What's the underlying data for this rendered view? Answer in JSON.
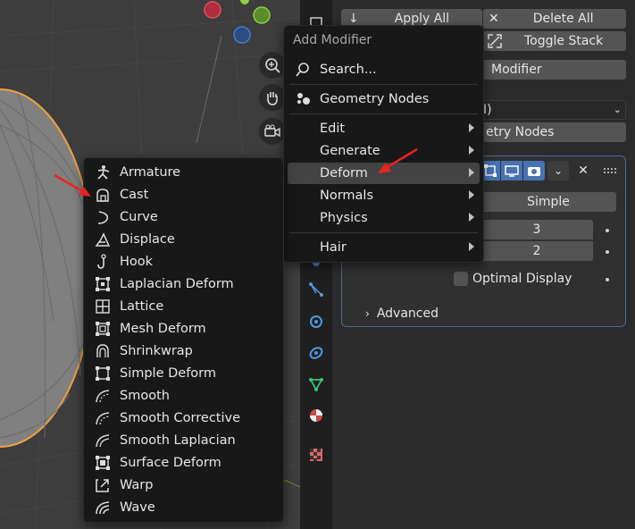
{
  "toolbar": {
    "apply_all": "Apply All",
    "delete_all": "Delete All",
    "toggle_stack": "Toggle Stack",
    "add_modifier": "Modifier",
    "dropdown_value": "I)",
    "geometry_nodes_btn": "etry Nodes"
  },
  "modifier_panel": {
    "mode_value": "Simple",
    "levels_viewport": "3",
    "render_levels": "2",
    "optimal_display": "Optimal Display",
    "advanced": "Advanced"
  },
  "add_modifier_menu": {
    "title": "Add Modifier",
    "search": "Search...",
    "geometry_nodes": "Geometry Nodes",
    "items": [
      "Edit",
      "Generate",
      "Deform",
      "Normals",
      "Physics"
    ],
    "hair": "Hair",
    "active_item": "Deform"
  },
  "deform_menu": {
    "items": [
      "Armature",
      "Cast",
      "Curve",
      "Displace",
      "Hook",
      "Laplacian Deform",
      "Lattice",
      "Mesh Deform",
      "Shrinkwrap",
      "Simple Deform",
      "Smooth",
      "Smooth Corrective",
      "Smooth Laplacian",
      "Surface Deform",
      "Warp",
      "Wave"
    ],
    "icons": [
      "armature-icon",
      "cast-icon",
      "curve-icon",
      "displace-icon",
      "hook-icon",
      "laplacian-deform-icon",
      "lattice-icon",
      "mesh-deform-icon",
      "shrinkwrap-icon",
      "simple-deform-icon",
      "smooth-icon",
      "smooth-corrective-icon",
      "smooth-laplacian-icon",
      "surface-deform-icon",
      "warp-icon",
      "wave-icon"
    ]
  },
  "colors": {
    "accent_red_arrow": "#e8231f",
    "selection_orange": "#f0a040",
    "panel_border": "#4f6d93",
    "menu_bg": "#181818",
    "active_row": "#434343"
  }
}
